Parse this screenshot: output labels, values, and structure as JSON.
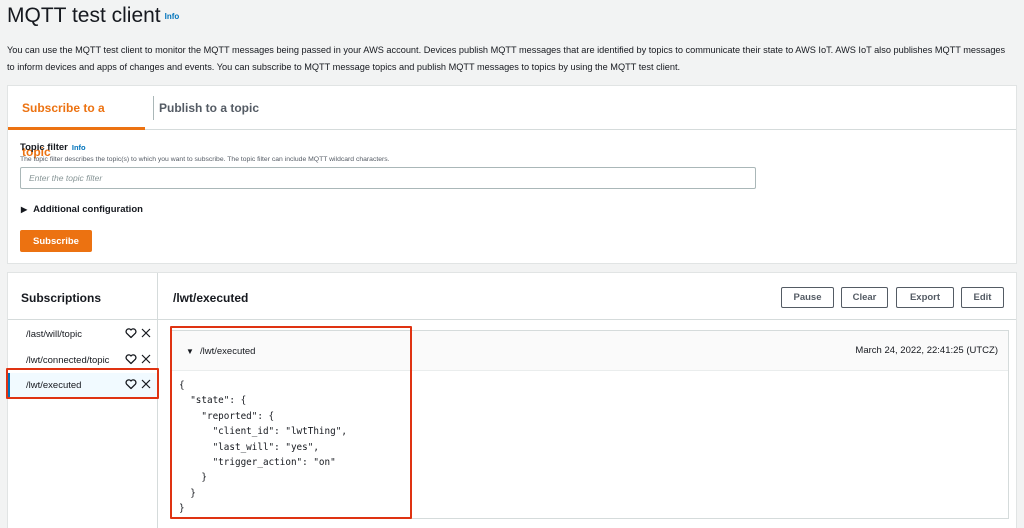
{
  "page": {
    "title": "MQTT test client",
    "info": "Info",
    "description": "You can use the MQTT test client to monitor the MQTT messages being passed in your AWS account. Devices publish MQTT messages that are identified by topics to communicate their state to AWS IoT. AWS IoT also publishes MQTT messages to inform devices and apps of changes and events. You can subscribe to MQTT message topics and publish MQTT messages to topics by using the MQTT test client."
  },
  "tabs": [
    {
      "label": "Subscribe to a topic",
      "active": true
    },
    {
      "label": "Publish to a topic",
      "active": false
    }
  ],
  "subscribe_form": {
    "topic_filter_label": "Topic filter",
    "info": "Info",
    "topic_filter_desc": "The topic filter describes the topic(s) to which you want to subscribe. The topic filter can include MQTT wildcard characters.",
    "topic_filter_value": "",
    "topic_filter_placeholder": "Enter the topic filter",
    "additional_config": "Additional configuration",
    "subscribe_label": "Subscribe"
  },
  "subscriptions": {
    "title": "Subscriptions",
    "items": [
      {
        "topic": "/last/will/topic"
      },
      {
        "topic": "/lwt/connected/topic"
      },
      {
        "topic": "/lwt/executed",
        "selected": true
      }
    ]
  },
  "messages": {
    "topic_title": "/lwt/executed",
    "buttons": {
      "pause": "Pause",
      "clear": "Clear",
      "export": "Export",
      "edit": "Edit"
    },
    "items": [
      {
        "topic": "/lwt/executed",
        "timestamp": "March 24, 2022, 22:41:25 (UTCZ)",
        "payload": "{\n  \"state\": {\n    \"reported\": {\n      \"client_id\": \"lwtThing\",\n      \"last_will\": \"yes\",\n      \"trigger_action\": \"on\"\n    }\n  }\n}"
      }
    ]
  },
  "colors": {
    "accent": "#ec7211",
    "link": "#0073bb",
    "highlight": "#df3312"
  },
  "icons": {
    "favorite": "heart-icon",
    "remove": "close-icon",
    "expand": "caret-right-icon",
    "collapse": "caret-down-icon"
  }
}
